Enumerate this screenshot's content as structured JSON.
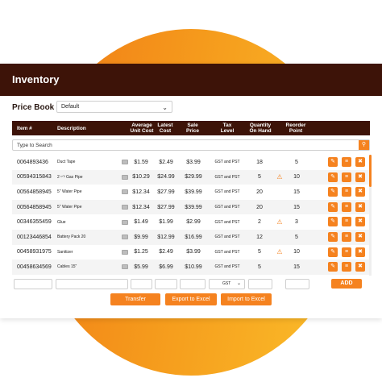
{
  "colors": {
    "accent": "#f5821f",
    "header_bg": "#3d1308",
    "bg_gradient_start": "#f07a16",
    "bg_gradient_end": "#fbbf2a"
  },
  "app": {
    "title": "Inventory"
  },
  "price_book": {
    "label": "Price Book",
    "selected": "Default"
  },
  "table": {
    "headers": {
      "item": "Item #",
      "description": "Description",
      "avg_cost": "Average Unit Cost",
      "latest_cost": "Latest Cost",
      "sale_price": "Sale Price",
      "tax_level": "Tax Level",
      "qty_on_hand": "Quantity On Hand",
      "reorder_point": "Reorder Point"
    },
    "search_placeholder": "Type to Search",
    "rows": [
      {
        "item": "0064893436",
        "description": "Duct Tape",
        "avg_cost": "$1.59",
        "latest_cost": "$2.49",
        "sale_price": "$3.99",
        "tax": "GST and PST",
        "qty": "18",
        "low_stock": false,
        "reorder": "5"
      },
      {
        "item": "00594315843",
        "description": "2 ¹ᐟ² Gas Pipe",
        "avg_cost": "$10.29",
        "latest_cost": "$24.99",
        "sale_price": "$29.99",
        "tax": "GST and PST",
        "qty": "5",
        "low_stock": true,
        "reorder": "10"
      },
      {
        "item": "00564858945",
        "description": "5\" Water Pipe",
        "avg_cost": "$12.34",
        "latest_cost": "$27.99",
        "sale_price": "$39.99",
        "tax": "GST and PST",
        "qty": "20",
        "low_stock": false,
        "reorder": "15"
      },
      {
        "item": "00564858945",
        "description": "5\" Water Pipe",
        "avg_cost": "$12.34",
        "latest_cost": "$27.99",
        "sale_price": "$39.99",
        "tax": "GST and PST",
        "qty": "20",
        "low_stock": false,
        "reorder": "15"
      },
      {
        "item": "00346355459",
        "description": "Glue",
        "avg_cost": "$1.49",
        "latest_cost": "$1.99",
        "sale_price": "$2.99",
        "tax": "GST and PST",
        "qty": "2",
        "low_stock": true,
        "reorder": "3"
      },
      {
        "item": "00123446854",
        "description": "Battery Pack 20",
        "avg_cost": "$9.99",
        "latest_cost": "$12.99",
        "sale_price": "$16.99",
        "tax": "GST and PST",
        "qty": "12",
        "low_stock": false,
        "reorder": "5"
      },
      {
        "item": "00458931975",
        "description": "Sanitizer",
        "avg_cost": "$1.25",
        "latest_cost": "$2.49",
        "sale_price": "$3.99",
        "tax": "GST and PST",
        "qty": "5",
        "low_stock": true,
        "reorder": "10"
      },
      {
        "item": "00458634569",
        "description": "Cables 15\"",
        "avg_cost": "$5.99",
        "latest_cost": "$6.99",
        "sale_price": "$10.99",
        "tax": "GST and PST",
        "qty": "5",
        "low_stock": false,
        "reorder": "15"
      }
    ]
  },
  "add_row": {
    "tax_default": "GST",
    "add_label": "ADD"
  },
  "footer": {
    "transfer": "Transfer",
    "export": "Export to Excel",
    "import": "Import to Excel"
  },
  "icons": {
    "edit": "edit-icon",
    "adjust": "sliders-icon",
    "delete": "trash-icon",
    "search": "search-icon",
    "warning": "warning-icon",
    "image": "image-icon"
  }
}
